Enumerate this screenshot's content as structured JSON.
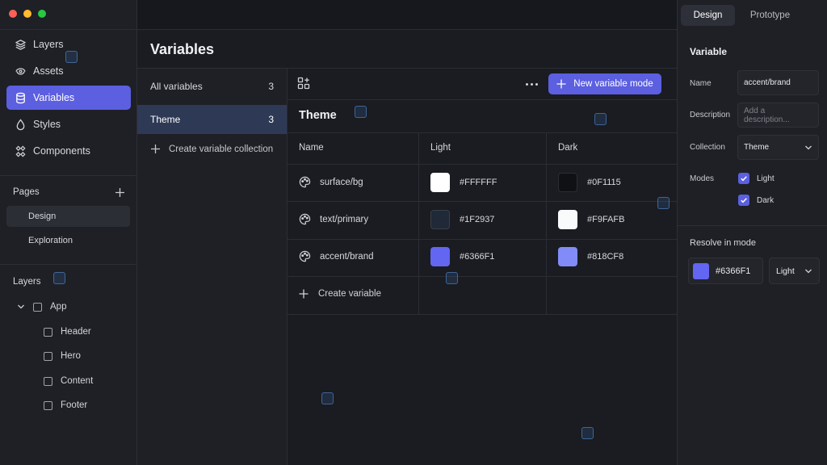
{
  "sidebar": {
    "nav": [
      {
        "label": "Layers",
        "icon": "layers-icon"
      },
      {
        "label": "Assets",
        "icon": "assets-icon"
      },
      {
        "label": "Variables",
        "icon": "database-icon",
        "active": true
      },
      {
        "label": "Styles",
        "icon": "droplet-icon"
      },
      {
        "label": "Components",
        "icon": "components-icon"
      }
    ],
    "pages_title": "Pages",
    "pages": [
      {
        "label": "Design",
        "active": true
      },
      {
        "label": "Exploration"
      }
    ],
    "layers_title": "Layers",
    "layers": [
      {
        "label": "App"
      },
      {
        "label": "Header"
      },
      {
        "label": "Hero"
      },
      {
        "label": "Content"
      },
      {
        "label": "Footer"
      }
    ]
  },
  "variables_panel": {
    "title": "Variables",
    "collections": [
      {
        "label": "All variables",
        "count": "3"
      },
      {
        "label": "Theme",
        "count": "3",
        "active": true
      }
    ],
    "create_collection_label": "Create variable collection",
    "new_mode_label": "New variable mode",
    "collection_title": "Theme",
    "columns": [
      "Name",
      "Light",
      "Dark"
    ],
    "rows": [
      {
        "name": "surface/bg",
        "light": "#FFFFFF",
        "dark": "#0F1115"
      },
      {
        "name": "text/primary",
        "light": "#1F2937",
        "dark": "#F9FAFB"
      },
      {
        "name": "accent/brand",
        "light": "#6366F1",
        "dark": "#818CF8"
      }
    ],
    "create_variable_label": "Create variable"
  },
  "inspector": {
    "tabs": [
      {
        "label": "Design",
        "active": true
      },
      {
        "label": "Prototype"
      }
    ],
    "title": "Variable",
    "name_label": "Name",
    "name_value": "accent/brand",
    "description_label": "Description",
    "description_placeholder": "Add a description...",
    "collection_label": "Collection",
    "collection_value": "Theme",
    "modes_label": "Modes",
    "modes": [
      {
        "label": "Light",
        "checked": true
      },
      {
        "label": "Dark",
        "checked": true
      }
    ],
    "resolve_title": "Resolve in mode",
    "resolve_value": "#6366F1",
    "resolve_mode": "Light"
  },
  "colors": {
    "accent": "#5B5FE0",
    "traffic_red": "#FF5F57",
    "traffic_yellow": "#FEBC2E",
    "traffic_green": "#28C840"
  }
}
